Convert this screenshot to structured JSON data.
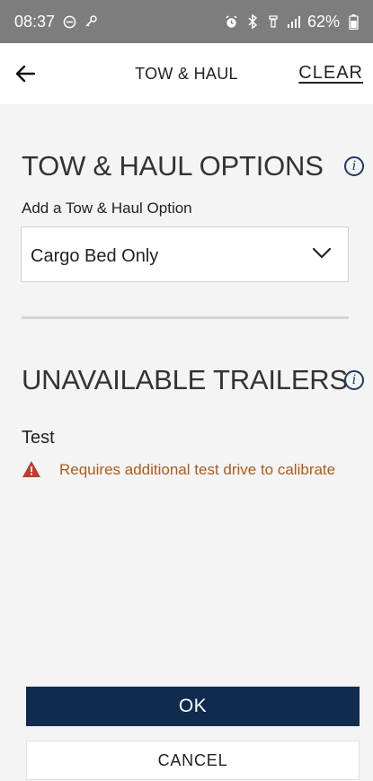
{
  "status_bar": {
    "time": "08:37",
    "battery": "62%",
    "icons": [
      "do-not-disturb-icon",
      "key-icon",
      "alarm-icon",
      "bluetooth-icon",
      "wifi-calling-icon",
      "signal-icon",
      "battery-icon"
    ]
  },
  "app_bar": {
    "title": "TOW & HAUL",
    "clear_label": "CLEAR"
  },
  "options_section": {
    "title": "TOW & HAUL OPTIONS",
    "field_label": "Add a Tow & Haul Option",
    "selected_value": "Cargo Bed Only"
  },
  "unavailable_section": {
    "title": "UNAVAILABLE TRAILERS",
    "trailers": [
      {
        "name": "Test",
        "warning": "Requires additional test drive to calibrate"
      }
    ]
  },
  "buttons": {
    "ok_label": "OK",
    "cancel_label": "CANCEL"
  },
  "colors": {
    "primary": "#112b4f",
    "warning": "#b05a1a",
    "warning_icon": "#c0392b",
    "status_bar": "#7d7d7d",
    "background": "#f4f4f4"
  }
}
